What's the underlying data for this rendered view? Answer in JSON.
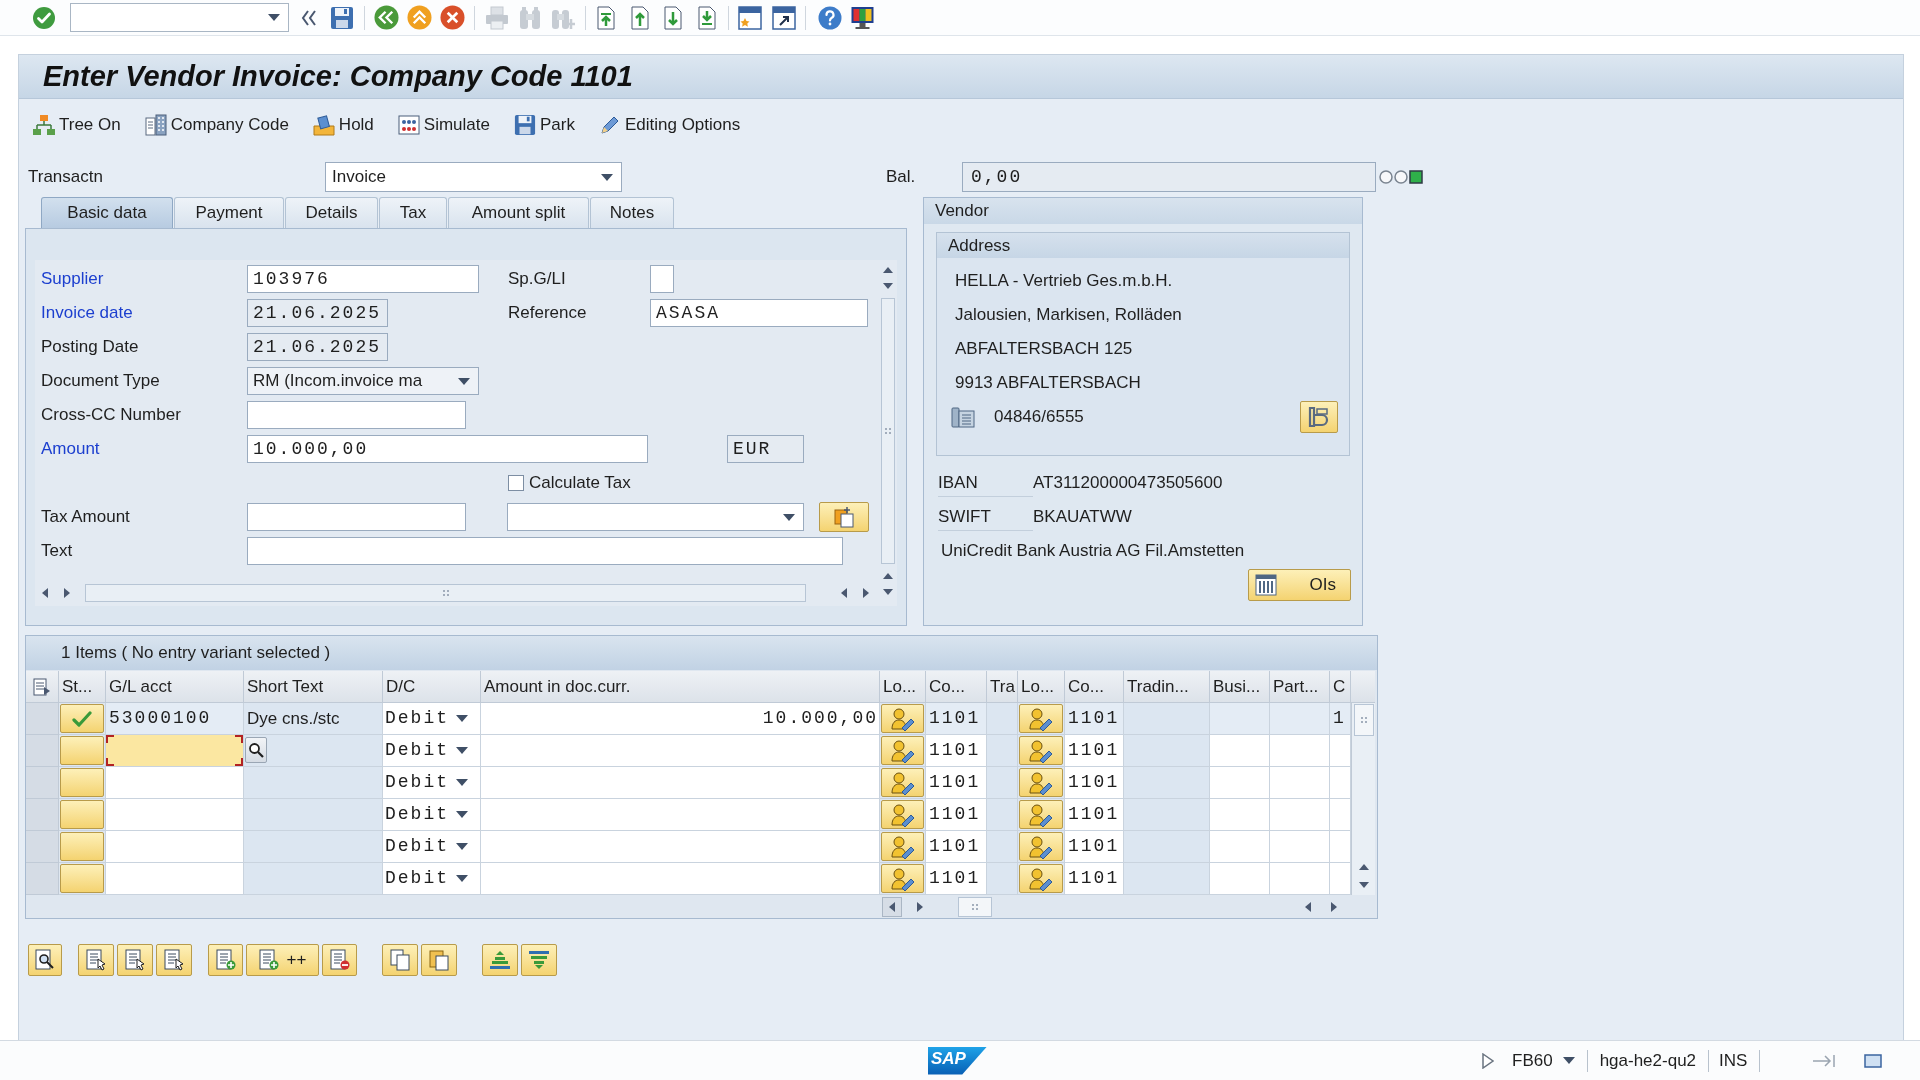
{
  "title": "Enter Vendor Invoice: Company Code 1101",
  "app_toolbar": [
    {
      "label": "Tree On"
    },
    {
      "label": "Company Code"
    },
    {
      "label": "Hold"
    },
    {
      "label": "Simulate"
    },
    {
      "label": "Park"
    },
    {
      "label": "Editing Options"
    }
  ],
  "transaction": {
    "label": "Transactn",
    "value": "Invoice"
  },
  "balance": {
    "label": "Bal.",
    "value": "0,00",
    "lamps": [
      {
        "on": false
      },
      {
        "on": false
      },
      {
        "on": true
      }
    ]
  },
  "tabs": [
    {
      "label": "Basic data",
      "selected": true
    },
    {
      "label": "Payment",
      "selected": false
    },
    {
      "label": "Details",
      "selected": false
    },
    {
      "label": "Tax",
      "selected": false
    },
    {
      "label": "Amount split",
      "selected": false
    },
    {
      "label": "Notes",
      "selected": false
    }
  ],
  "basic_data": {
    "supplier": {
      "label": "Supplier",
      "value": "103976",
      "highlighted": true,
      "shaded": false
    },
    "special_gl": {
      "label": "Sp.G/LI",
      "highlighted": false,
      "shaded": false
    },
    "invoice_date": {
      "label": "Invoice date",
      "value": "21.06.2025",
      "highlighted": true,
      "shaded": true
    },
    "reference": {
      "label": "Reference",
      "value": "ASASA",
      "highlighted": false,
      "shaded": false
    },
    "posting_date": {
      "label": "Posting Date",
      "value": "21.06.2025",
      "highlighted": false,
      "shaded": true
    },
    "document_type": {
      "label": "Document Type",
      "value": "RM (Incom.invoice ma",
      "highlighted": false
    },
    "cross_cc_number": {
      "label": "Cross-CC Number",
      "highlighted": false,
      "shaded": false
    },
    "amount": {
      "label": "Amount",
      "value": "10.000,00",
      "highlighted": true,
      "shaded": false
    },
    "currency": {
      "value": "EUR",
      "shaded": true
    },
    "calculate_tax": {
      "label": "Calculate Tax",
      "checked": false
    },
    "tax_amount": {
      "label": "Tax Amount",
      "highlighted": false,
      "shaded": false
    },
    "text": {
      "label": "Text",
      "highlighted": false,
      "shaded": false
    }
  },
  "vendor": {
    "title": "Vendor",
    "address": {
      "title": "Address",
      "lines": [
        "HELLA - Vertrieb Ges.m.b.H.",
        "Jalousien, Markisen, Rolläden",
        "ABFALTERSBACH 125",
        "9913 ABFALTERSBACH"
      ],
      "phone": "04846/6555"
    },
    "bank_details": [
      {
        "label": "IBAN",
        "value": "AT311200000473505600"
      },
      {
        "label": "SWIFT",
        "value": "BKAUATWW"
      }
    ],
    "bank_name": "UniCredit Bank Austria AG Fil.Amstetten",
    "button": "OIs"
  },
  "items": {
    "title": "1 Items ( No entry variant selected )",
    "columns": [
      {
        "label": "St...",
        "kind": "status"
      },
      {
        "label": "G/L acct",
        "kind": "input"
      },
      {
        "label": "Short Text",
        "kind": "readonly"
      },
      {
        "label": "D/C",
        "kind": "dropdown"
      },
      {
        "label": "Amount in doc.curr.",
        "kind": "amount"
      },
      {
        "label": "Lo...",
        "kind": "button"
      },
      {
        "label": "Co...",
        "kind": "input"
      },
      {
        "label": "Tra",
        "kind": "readonly"
      },
      {
        "label": "Lo...",
        "kind": "button"
      },
      {
        "label": "Co...",
        "kind": "input"
      },
      {
        "label": "Tradin...",
        "kind": "readonly"
      },
      {
        "label": "Busi...",
        "kind": "input"
      },
      {
        "label": "Part...",
        "kind": "input"
      },
      {
        "label": "C",
        "kind": "input"
      }
    ],
    "rows": [
      {
        "checked": true,
        "focused": false,
        "gl_acct": "53000100",
        "short_text": "Dye cns./stc",
        "d_c": "Debit",
        "amount": "10.000,00",
        "column_7": "1101",
        "column_10": "1101",
        "column_14": "1"
      },
      {
        "checked": false,
        "focused": true,
        "d_c": "Debit",
        "column_7": "1101",
        "column_10": "1101"
      },
      {
        "checked": false,
        "focused": false,
        "d_c": "Debit",
        "column_7": "1101",
        "column_10": "1101"
      },
      {
        "checked": false,
        "focused": false,
        "d_c": "Debit",
        "column_7": "1101",
        "column_10": "1101"
      },
      {
        "checked": false,
        "focused": false,
        "d_c": "Debit",
        "column_7": "1101",
        "column_10": "1101"
      },
      {
        "checked": false,
        "focused": false,
        "d_c": "Debit",
        "column_7": "1101",
        "column_10": "1101"
      }
    ]
  },
  "bottom_toolbar": {
    "button_text": "++"
  },
  "status_bar": {
    "logo": "SAP",
    "transaction": "FB60",
    "server": "hga-he2-qu2",
    "mode": "INS"
  }
}
